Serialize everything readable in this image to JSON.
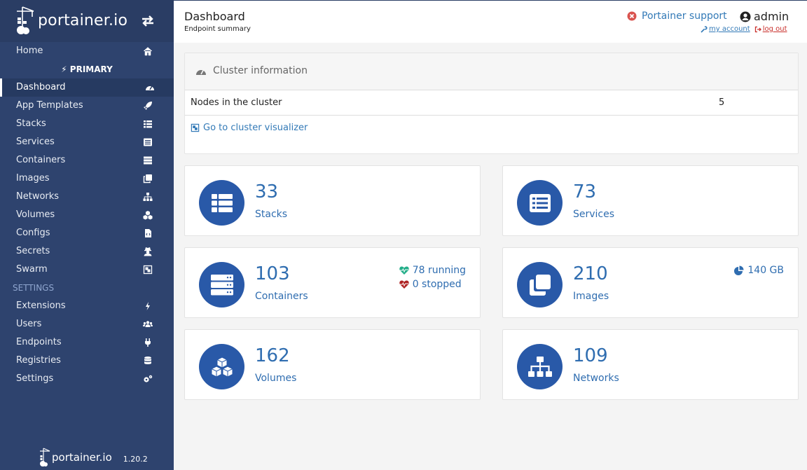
{
  "brand": {
    "logo_text": "portainer.io",
    "version": "1.20.2"
  },
  "sidebar": {
    "home": "Home",
    "endpoint": "PRIMARY",
    "items": [
      {
        "label": "Dashboard",
        "icon": "tachometer-icon"
      },
      {
        "label": "App Templates",
        "icon": "rocket-icon"
      },
      {
        "label": "Stacks",
        "icon": "th-list-icon"
      },
      {
        "label": "Services",
        "icon": "list-alt-icon"
      },
      {
        "label": "Containers",
        "icon": "server-icon"
      },
      {
        "label": "Images",
        "icon": "clone-icon"
      },
      {
        "label": "Networks",
        "icon": "sitemap-icon"
      },
      {
        "label": "Volumes",
        "icon": "cubes-icon"
      },
      {
        "label": "Configs",
        "icon": "file-code-icon"
      },
      {
        "label": "Secrets",
        "icon": "user-secret-icon"
      },
      {
        "label": "Swarm",
        "icon": "object-group-icon"
      }
    ],
    "settings_heading": "SETTINGS",
    "settings_items": [
      {
        "label": "Extensions",
        "icon": "bolt-icon"
      },
      {
        "label": "Users",
        "icon": "users-icon"
      },
      {
        "label": "Endpoints",
        "icon": "plug-icon"
      },
      {
        "label": "Registries",
        "icon": "database-icon"
      },
      {
        "label": "Settings",
        "icon": "cogs-icon"
      }
    ]
  },
  "header": {
    "title": "Dashboard",
    "subtitle": "Endpoint summary",
    "support": "Portainer support",
    "user": "admin",
    "my_account": "my account",
    "log_out": "log out"
  },
  "cluster": {
    "title": "Cluster information",
    "nodes_label": "Nodes in the cluster",
    "nodes_value": "5",
    "visualizer_link": "Go to cluster visualizer"
  },
  "tiles": {
    "stacks": {
      "value": "33",
      "label": "Stacks"
    },
    "services": {
      "value": "73",
      "label": "Services"
    },
    "containers": {
      "value": "103",
      "label": "Containers",
      "running": "78 running",
      "stopped": "0 stopped"
    },
    "images": {
      "value": "210",
      "label": "Images",
      "size": "140 GB"
    },
    "volumes": {
      "value": "162",
      "label": "Volumes"
    },
    "networks": {
      "value": "109",
      "label": "Networks"
    }
  },
  "colors": {
    "sidebar": "#2e436e",
    "accent": "#2959a8",
    "link": "#337ab7",
    "running": "#23ae89",
    "stopped": "#ae2323"
  }
}
